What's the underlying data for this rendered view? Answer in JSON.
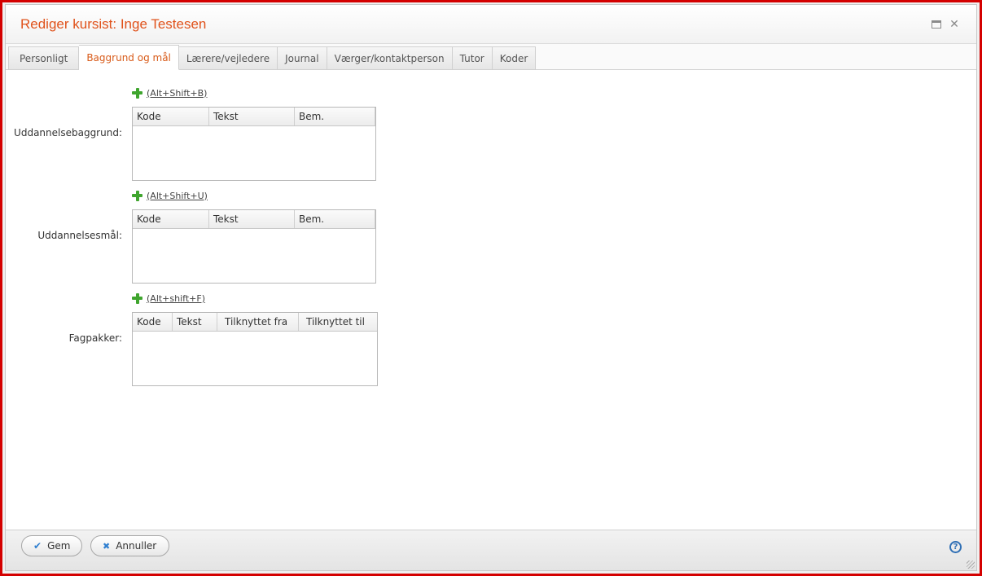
{
  "window": {
    "title": "Rediger kursist: Inge Testesen"
  },
  "tabs": [
    {
      "label": "Personligt"
    },
    {
      "label": "Baggrund og mål"
    },
    {
      "label": "Lærere/vejledere"
    },
    {
      "label": "Journal"
    },
    {
      "label": "Værger/kontaktperson"
    },
    {
      "label": "Tutor"
    },
    {
      "label": "Koder"
    }
  ],
  "sections": {
    "background": {
      "label": "Uddannelsebaggrund:",
      "add_shortcut": "(Alt+Shift+B)",
      "columns": [
        "Kode",
        "Tekst",
        "Bem."
      ]
    },
    "goal": {
      "label": "Uddannelsesmål:",
      "add_shortcut": "(Alt+Shift+U)",
      "columns": [
        "Kode",
        "Tekst",
        "Bem."
      ]
    },
    "packages": {
      "label": "Fagpakker:",
      "add_shortcut": "(Alt+shift+F)",
      "columns": [
        "Kode",
        "Tekst",
        "Tilknyttet fra",
        "Tilknyttet til"
      ]
    }
  },
  "footer": {
    "save_label": "Gem",
    "cancel_label": "Annuller",
    "help_glyph": "?"
  },
  "colors": {
    "title": "#e0521b",
    "active_tab": "#d85a18",
    "window_border": "#d40000",
    "plus_icon": "#3fa52e",
    "button_icon": "#2f7fd0"
  }
}
